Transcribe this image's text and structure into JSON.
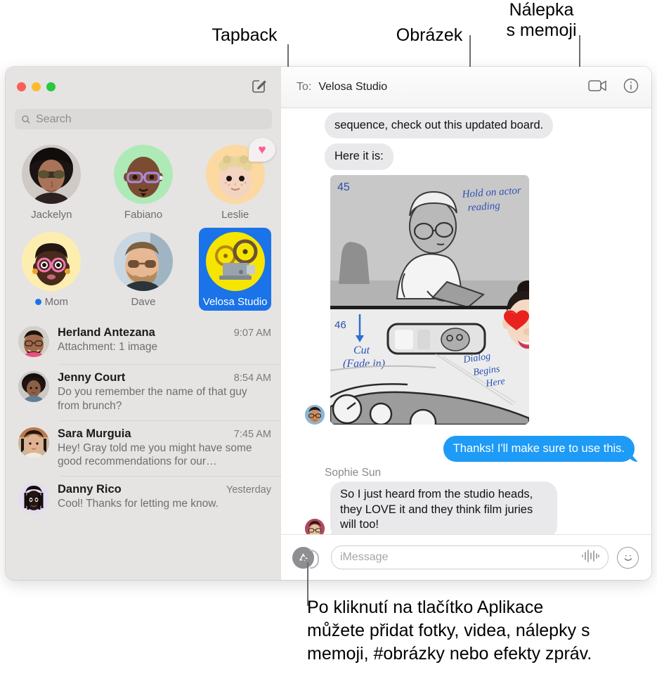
{
  "annotations": {
    "tapback": {
      "label": "Tapback"
    },
    "obrazek": {
      "label": "Obrázek"
    },
    "nalepka": {
      "label": "Nálepka\ns memoji"
    },
    "bottom": {
      "text": "Po kliknutí na tlačítko Aplikace můžete přidat fotky, videa, nálepky s memoji, #obrázky nebo efekty zpráv."
    }
  },
  "window": {
    "traffic_lights": {
      "close": "close-button",
      "minimize": "minimize-button",
      "zoom": "zoom-button"
    },
    "compose_icon": "compose-icon"
  },
  "sidebar": {
    "search": {
      "placeholder": "Search",
      "icon": "search-icon"
    },
    "pinned": [
      {
        "name": "Jackelyn",
        "avatar_kind": "photo",
        "bg": "#d8d6d4",
        "glyph": "",
        "unread": false,
        "selected": false,
        "tapback": null
      },
      {
        "name": "Fabiano",
        "avatar_kind": "memoji",
        "bg": "#aeeab6",
        "glyph": "🧑🏾‍🦲",
        "unread": false,
        "selected": false,
        "tapback": null
      },
      {
        "name": "Leslie",
        "avatar_kind": "memoji",
        "bg": "#fbd9a0",
        "glyph": "🧒🏼",
        "unread": false,
        "selected": false,
        "tapback": "♥"
      },
      {
        "name": "Mom",
        "avatar_kind": "memoji",
        "bg": "#fdeeb0",
        "glyph": "👩🏿",
        "unread": true,
        "selected": false,
        "tapback": null
      },
      {
        "name": "Dave",
        "avatar_kind": "photo",
        "bg": "#cfd9e0",
        "glyph": "",
        "unread": false,
        "selected": false,
        "tapback": null
      },
      {
        "name": "Velosa Studio",
        "avatar_kind": "emoji",
        "bg": "#f6e500",
        "glyph": "📽",
        "unread": false,
        "selected": true,
        "tapback": null
      }
    ],
    "conversations": [
      {
        "name": "Herland Antezana",
        "time": "9:07 AM",
        "preview": "Attachment: 1 image",
        "avatar_bg": "#d6d2cc",
        "glyph": ""
      },
      {
        "name": "Jenny Court",
        "time": "8:54 AM",
        "preview": "Do you remember the name of that guy from brunch?",
        "avatar_bg": "#d2cfcb",
        "glyph": ""
      },
      {
        "name": "Sara Murguia",
        "time": "7:45 AM",
        "preview": "Hey! Gray told me you might have some good recommendations for our…",
        "avatar_bg": "#cdc6c0",
        "glyph": ""
      },
      {
        "name": "Danny Rico",
        "time": "Yesterday",
        "preview": "Cool! Thanks for letting me know.",
        "avatar_bg": "#e3dcf2",
        "glyph": "👨🏿‍🦱"
      }
    ]
  },
  "conversation": {
    "to_label": "To:",
    "to_value": "Velosa Studio",
    "header_icons": {
      "facetime": "video-camera-icon",
      "details": "info-icon"
    },
    "messages": [
      {
        "type": "incoming-text",
        "text": "sequence, check out this updated board."
      },
      {
        "type": "incoming-text",
        "text": "Here it is:"
      },
      {
        "type": "incoming-image",
        "caption": "storyboard-image",
        "image_notes": {
          "panel_number_top": "45",
          "panel_number_bottom": "46",
          "note_1": "Hold on actor reading",
          "note_2": "Cut (Fade in)",
          "note_3": "Dialog Begins Here"
        },
        "sticker": "heart-eyes-memoji-sticker"
      },
      {
        "type": "outgoing-text",
        "text": "Thanks! I'll make sure to use this."
      },
      {
        "type": "incoming-text",
        "sender": "Sophie Sun",
        "text": "So I just heard from the studio heads, they LOVE it and they think film juries will too!"
      }
    ],
    "footer": {
      "apps_icon": "apps-store-icon",
      "input_placeholder": "iMessage",
      "audio_icon": "audio-waveform-icon",
      "emoji_icon": "emoji-smiley-icon"
    }
  },
  "colors": {
    "accent_blue": "#1a73e8",
    "bubble_blue": "#1d9bf6",
    "bubble_gray": "#e9e9eb",
    "sidebar_bg": "#e6e3e3",
    "tapback_pink": "#ff5b92"
  }
}
